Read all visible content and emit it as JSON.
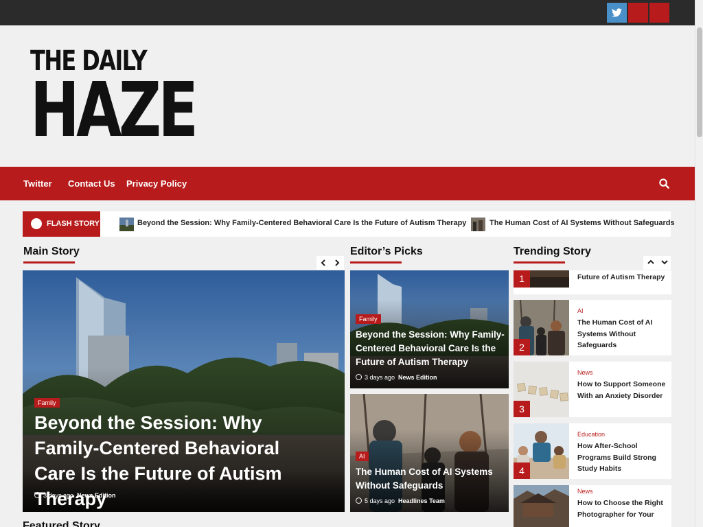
{
  "topbar": {
    "social": [
      {
        "name": "twitter-icon",
        "color": "#4a90c8"
      },
      {
        "name": "social-link-icon",
        "color": "#b81b1b"
      },
      {
        "name": "social-link-icon",
        "color": "#b81b1b"
      }
    ]
  },
  "header": {
    "logo_top": "THE DAILY",
    "logo_bottom": "HAZE"
  },
  "nav": {
    "items": [
      "Twitter",
      "Contact Us",
      "Privacy Policy"
    ],
    "search_icon": "search-icon"
  },
  "flash": {
    "label": "FLASH STORY",
    "items": [
      "Beyond the Session: Why Family-Centered Behavioral Care Is the Future of Autism Therapy",
      "The Human Cost of AI Systems Without Safeguards"
    ]
  },
  "main_story": {
    "section_title": "Main Story",
    "category": "Family",
    "title": "Beyond the Session: Why Family-Centered Behavioral Care Is the Future of Autism Therapy",
    "time": "3 days ago",
    "author": "News Edition"
  },
  "editors_picks": {
    "section_title": "Editor’s Picks",
    "items": [
      {
        "category": "Family",
        "title": "Beyond the Session: Why Family-Centered Behavioral Care Is the Future of Autism Therapy",
        "time": "3 days ago",
        "author": "News Edition"
      },
      {
        "category": "AI",
        "title": "The Human Cost of AI Systems Without Safeguards",
        "time": "5 days ago",
        "author": "Headlines Team"
      }
    ]
  },
  "trending": {
    "section_title": "Trending Story",
    "items": [
      {
        "num": "1",
        "category": "",
        "title": "Future of Autism Therapy"
      },
      {
        "num": "2",
        "category": "AI",
        "title": "The Human Cost of AI Systems Without Safeguards"
      },
      {
        "num": "3",
        "category": "News",
        "title": "How to Support Someone With an Anxiety Disorder"
      },
      {
        "num": "4",
        "category": "Education",
        "title": "How After-School Programs Build Strong Study Habits"
      },
      {
        "num": "",
        "category": "News",
        "title": "How to Choose the Right Photographer for Your"
      }
    ]
  },
  "featured": {
    "section_title": "Featured Story"
  },
  "colors": {
    "accent": "#b81b1b",
    "topbar": "#2b2b2b",
    "background": "#f0f0f0"
  }
}
